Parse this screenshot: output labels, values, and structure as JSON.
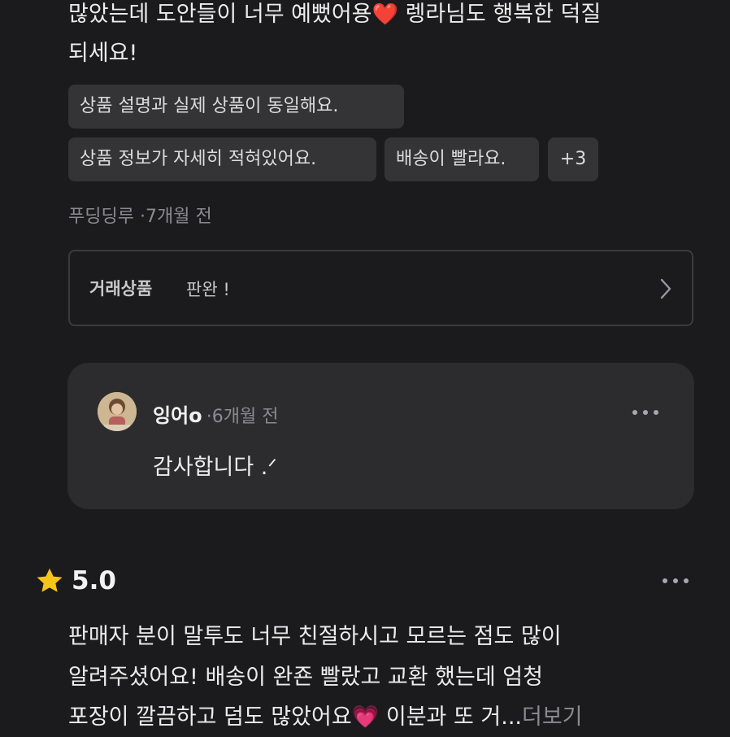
{
  "review1": {
    "text_line1": "많았는데 도안들이 너무 예뻤어용",
    "emoji1": "❤️",
    "text_line1_end": " 렝라님도 행복한 덕질",
    "text_line2": "되세요!",
    "tags": [
      "상품 설명과 실제 상품이 동일해요.",
      "상품 정보가 자세히 적혀있어요.",
      "배송이 빨라요.",
      "+3"
    ],
    "author": "푸딩딩루",
    "separator": "·",
    "time": "7개월 전",
    "product_label": "거래상품",
    "product_name": "판완 !",
    "chevron_icon": "chevron-right-icon"
  },
  "reply": {
    "author": "잉어o",
    "separator": "·",
    "time": "6개월 전",
    "text": "감사합니다 .ᐟ",
    "menu_icon": "more-horizontal-icon"
  },
  "review2": {
    "star_icon": "star-icon",
    "star_color": "#f5c518",
    "rating": "5.0",
    "text_line1": "판매자 분이 말투도 너무 친절하시고 모르는 점도 많이",
    "text_line2": "알려주셨어요! 배송이 완죤 빨랐고 교환 했는데 엄청",
    "text_line3": "포장이 깔끔하고 덤도 많았어요",
    "emoji": "💗",
    "text_line3_end": " 이분과 또 거...",
    "more_label": "더보기",
    "menu_icon": "more-horizontal-icon"
  }
}
